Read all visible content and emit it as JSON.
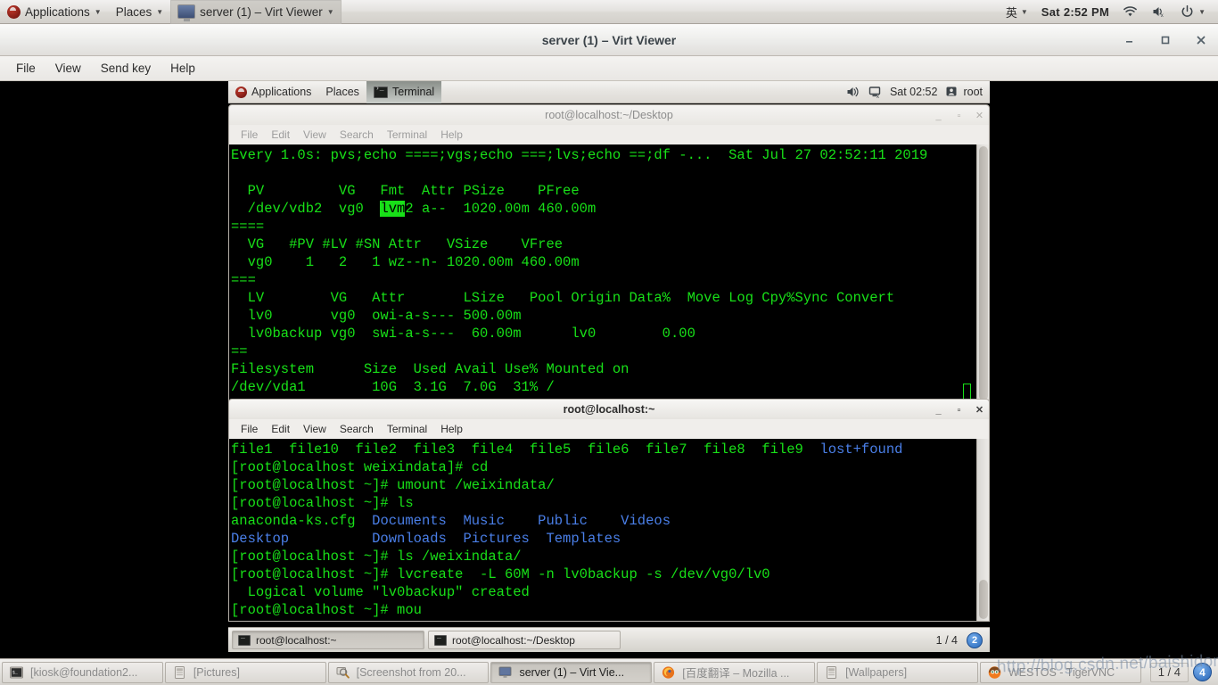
{
  "host_top_panel": {
    "applications_label": "Applications",
    "places_label": "Places",
    "window_menu_label": "server (1) – Virt Viewer",
    "input_method": "英",
    "clock": "Sat 2:52 PM"
  },
  "virt_viewer": {
    "title": "server (1) – Virt Viewer",
    "menu": [
      "File",
      "View",
      "Send key",
      "Help"
    ],
    "window_controls": {
      "minimize": "－",
      "maximize": "▫",
      "close": "✕"
    }
  },
  "guest_panel": {
    "applications_label": "Applications",
    "places_label": "Places",
    "active_app_label": "Terminal",
    "clock": "Sat 02:52",
    "user": "root"
  },
  "terminal_watch": {
    "title": "root@localhost:~/Desktop",
    "menu": [
      "File",
      "Edit",
      "View",
      "Search",
      "Terminal",
      "Help"
    ],
    "lines": [
      "Every 1.0s: pvs;echo ====;vgs;echo ===;lvs;echo ==;df -...  Sat Jul 27 02:52:11 2019",
      "",
      "  PV         VG   Fmt  Attr PSize    PFree",
      "  /dev/vdb2  vg0  lvm2 a--  1020.00m 460.00m",
      "====",
      "  VG   #PV #LV #SN Attr   VSize    VFree",
      "  vg0    1   2   1 wz--n- 1020.00m 460.00m",
      "===",
      "  LV        VG   Attr       LSize   Pool Origin Data%  Move Log Cpy%Sync Convert",
      "  lv0       vg0  owi-a-s--- 500.00m",
      "  lv0backup vg0  swi-a-s---  60.00m      lv0        0.00",
      "==",
      "Filesystem      Size  Used Avail Use% Mounted on",
      "/dev/vda1        10G  3.1G  7.0G  31% /"
    ],
    "highlight_word": "lvm",
    "highlight_line_index": 3
  },
  "terminal_shell": {
    "title": "root@localhost:~",
    "menu": [
      "File",
      "Edit",
      "View",
      "Search",
      "Terminal",
      "Help"
    ],
    "lines": [
      [
        {
          "t": "file1  file10  file2  file3  file4  file5  file6  file7  file8  file9  ",
          "c": "green"
        },
        {
          "t": "lost+found",
          "c": "blue"
        }
      ],
      [
        {
          "t": "[root@localhost weixindata]# cd",
          "c": "green"
        }
      ],
      [
        {
          "t": "[root@localhost ~]# umount /weixindata/",
          "c": "green"
        }
      ],
      [
        {
          "t": "[root@localhost ~]# ls",
          "c": "green"
        }
      ],
      [
        {
          "t": "anaconda-ks.cfg  ",
          "c": "green"
        },
        {
          "t": "Documents  Music    Public    Videos",
          "c": "blue"
        }
      ],
      [
        {
          "t": "Desktop          Downloads  Pictures  Templates",
          "c": "blue"
        }
      ],
      [
        {
          "t": "[root@localhost ~]# ls /weixindata/",
          "c": "green"
        }
      ],
      [
        {
          "t": "[root@localhost ~]# lvcreate  -L 60M -n lv0backup -s /dev/vg0/lv0",
          "c": "green"
        }
      ],
      [
        {
          "t": "  Logical volume \"lv0backup\" created",
          "c": "green"
        }
      ],
      [
        {
          "t": "[root@localhost ~]# mou",
          "c": "green"
        }
      ]
    ]
  },
  "guest_taskbar": {
    "buttons": [
      {
        "label": "root@localhost:~",
        "state": "pressed"
      },
      {
        "label": "root@localhost:~/Desktop",
        "state": "normal"
      }
    ],
    "pager": "1 / 4",
    "workspace_badge": "2"
  },
  "host_taskbar": {
    "buttons": [
      {
        "label": "[kiosk@foundation2...",
        "icon": "terminal-icon",
        "state": "normal"
      },
      {
        "label": "[Pictures]",
        "icon": "file-manager-icon",
        "state": "normal"
      },
      {
        "label": "[Screenshot from 20...",
        "icon": "screenshot-icon",
        "state": "normal"
      },
      {
        "label": "server (1) – Virt Vie...",
        "icon": "virt-viewer-icon",
        "state": "pressed"
      },
      {
        "label": "[百度翻译 – Mozilla ...",
        "icon": "firefox-icon",
        "state": "normal"
      },
      {
        "label": "[Wallpapers]",
        "icon": "file-manager-icon",
        "state": "normal"
      },
      {
        "label": "WESTOS - TigerVNC",
        "icon": "tigervnc-icon",
        "state": "normal"
      }
    ],
    "pager": "1 / 4",
    "workspace_badge": "4"
  },
  "watermark": "http://blog.csdn.net/baishidong"
}
